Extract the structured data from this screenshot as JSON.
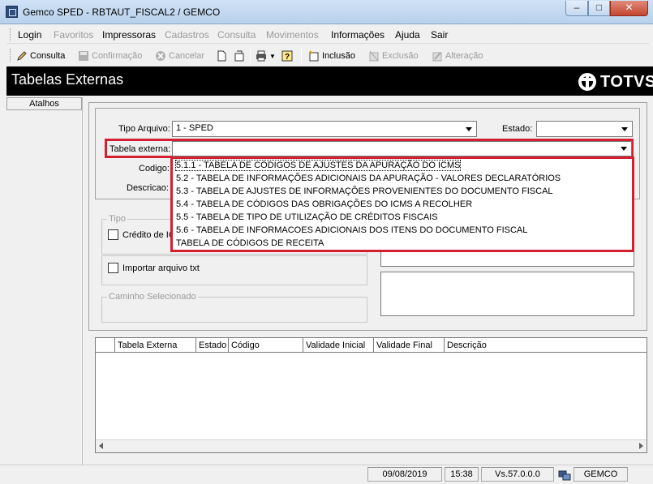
{
  "window": {
    "title": "Gemco SPED - RBTAUT_FISCAL2 / GEMCO"
  },
  "menu": [
    {
      "label": "Login",
      "enabled": true
    },
    {
      "label": "Favoritos",
      "enabled": false
    },
    {
      "label": "Impressoras",
      "enabled": true
    },
    {
      "label": "Cadastros",
      "enabled": false
    },
    {
      "label": "Consulta",
      "enabled": false
    },
    {
      "label": "Movimentos",
      "enabled": false
    },
    {
      "label": "Informações",
      "enabled": true
    },
    {
      "label": "Ajuda",
      "enabled": true
    },
    {
      "label": "Sair",
      "enabled": true
    }
  ],
  "toolbar": {
    "consulta": "Consulta",
    "confirmacao": "Confirmação",
    "cancelar": "Cancelar",
    "inclusao": "Inclusão",
    "exclusao": "Exclusão",
    "alteracao": "Alteração"
  },
  "header": {
    "title": "Tabelas Externas",
    "logo": "TOTVS"
  },
  "sidebar": {
    "atalhos": "Atalhos"
  },
  "form": {
    "tipo_arquivo_label": "Tipo Arquivo:",
    "tipo_arquivo_value": "1 - SPED",
    "estado_label": "Estado:",
    "estado_value": "",
    "tabela_externa_label": "Tabela externa:",
    "tabela_externa_value": "",
    "codigo_label": "Codigo:",
    "descricao_label": "Descricao:"
  },
  "dropdown": {
    "options": [
      "5.1.1 - TABELA DE CÓDIGOS DE AJUSTES DA APURAÇÃO DO ICMS",
      "5.2 - TABELA DE INFORMAÇÕES ADICIONAIS DA APURAÇÃO - VALORES DECLARATÓRIOS",
      "5.3 - TABELA DE AJUSTES DE INFORMAÇÕES PROVENIENTES DO DOCUMENTO FISCAL",
      "5.4 - TABELA DE CÓDIGOS DAS OBRIGAÇÕES DO ICMS A RECOLHER",
      "5.5 - TABELA DE TIPO DE UTILIZAÇÃO DE CRÉDITOS FISCAIS",
      "5.6 - TABELA DE INFORMACOES ADICIONAIS DOS ITENS DO DOCUMENTO FISCAL",
      "TABELA DE CÓDIGOS DE RECEITA"
    ]
  },
  "tipo_group": {
    "legend": "Tipo",
    "credito_label": "Crédito de IC"
  },
  "importar_label": "Importar  arquivo  txt",
  "caminho_legend": "Caminho Selecionado",
  "grid": {
    "columns": [
      "Tabela Externa",
      "Estado",
      "Código",
      "Validade Inicial",
      "Validade Final",
      "Descrição"
    ]
  },
  "status": {
    "date": "09/08/2019",
    "time": "15:38",
    "version": "Vs.57.0.0.0",
    "user": "GEMCO"
  }
}
